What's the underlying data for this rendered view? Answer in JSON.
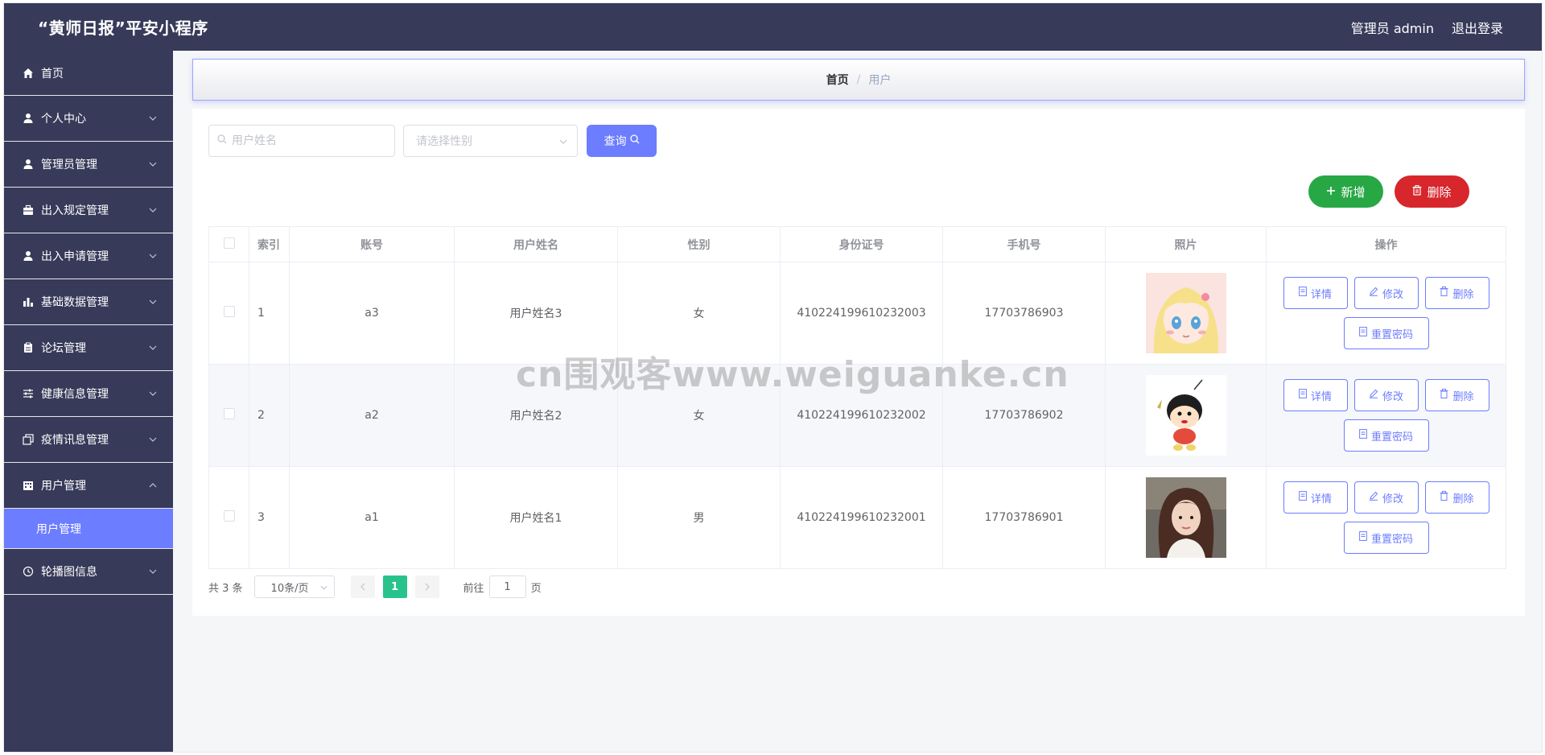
{
  "header": {
    "title": "“黄师日报”平安小程序",
    "user_label": "管理员 admin",
    "logout_label": "退出登录"
  },
  "sidebar": {
    "items": [
      {
        "label": "首页",
        "icon": "home-icon"
      },
      {
        "label": "个人中心",
        "icon": "user-icon"
      },
      {
        "label": "管理员管理",
        "icon": "user-icon"
      },
      {
        "label": "出入规定管理",
        "icon": "briefcase-icon"
      },
      {
        "label": "出入申请管理",
        "icon": "user-icon"
      },
      {
        "label": "基础数据管理",
        "icon": "bar-chart-icon"
      },
      {
        "label": "论坛管理",
        "icon": "clipboard-icon"
      },
      {
        "label": "健康信息管理",
        "icon": "sliders-icon"
      },
      {
        "label": "疫情讯息管理",
        "icon": "copy-icon"
      },
      {
        "label": "用户管理",
        "icon": "building-icon"
      },
      {
        "label": "轮播图信息",
        "icon": "clock-icon"
      }
    ],
    "active_sub": "用户管理"
  },
  "breadcrumb": {
    "home": "首页",
    "separator": "/",
    "current": "用户"
  },
  "search": {
    "name_placeholder": "用户姓名",
    "gender_placeholder": "请选择性别",
    "query_label": "查询"
  },
  "actions": {
    "add_label": "新增",
    "delete_label": "删除"
  },
  "table": {
    "headers": [
      "索引",
      "账号",
      "用户姓名",
      "性别",
      "身份证号",
      "手机号",
      "照片",
      "操作"
    ],
    "rows": [
      {
        "index": "1",
        "account": "a3",
        "name": "用户姓名3",
        "gender": "女",
        "id_card": "410224199610232003",
        "phone": "17703786903"
      },
      {
        "index": "2",
        "account": "a2",
        "name": "用户姓名2",
        "gender": "女",
        "id_card": "410224199610232002",
        "phone": "17703786902"
      },
      {
        "index": "3",
        "account": "a1",
        "name": "用户姓名1",
        "gender": "男",
        "id_card": "410224199610232001",
        "phone": "17703786901"
      }
    ],
    "ops": {
      "detail": "详情",
      "edit": "修改",
      "delete": "删除",
      "reset": "重置密码"
    }
  },
  "pager": {
    "total": "共 3 条",
    "page_size": "10条/页",
    "current_page": "1",
    "goto_label": "前往",
    "goto_value": "1",
    "unit": "页"
  },
  "watermark": "cn围观客www.weiguanke.cn",
  "colors": {
    "header_bg": "#373a59",
    "accent": "#6c7dff",
    "add_green": "#28a745",
    "delete_red": "#d7262c",
    "page_active": "#28c38c"
  }
}
